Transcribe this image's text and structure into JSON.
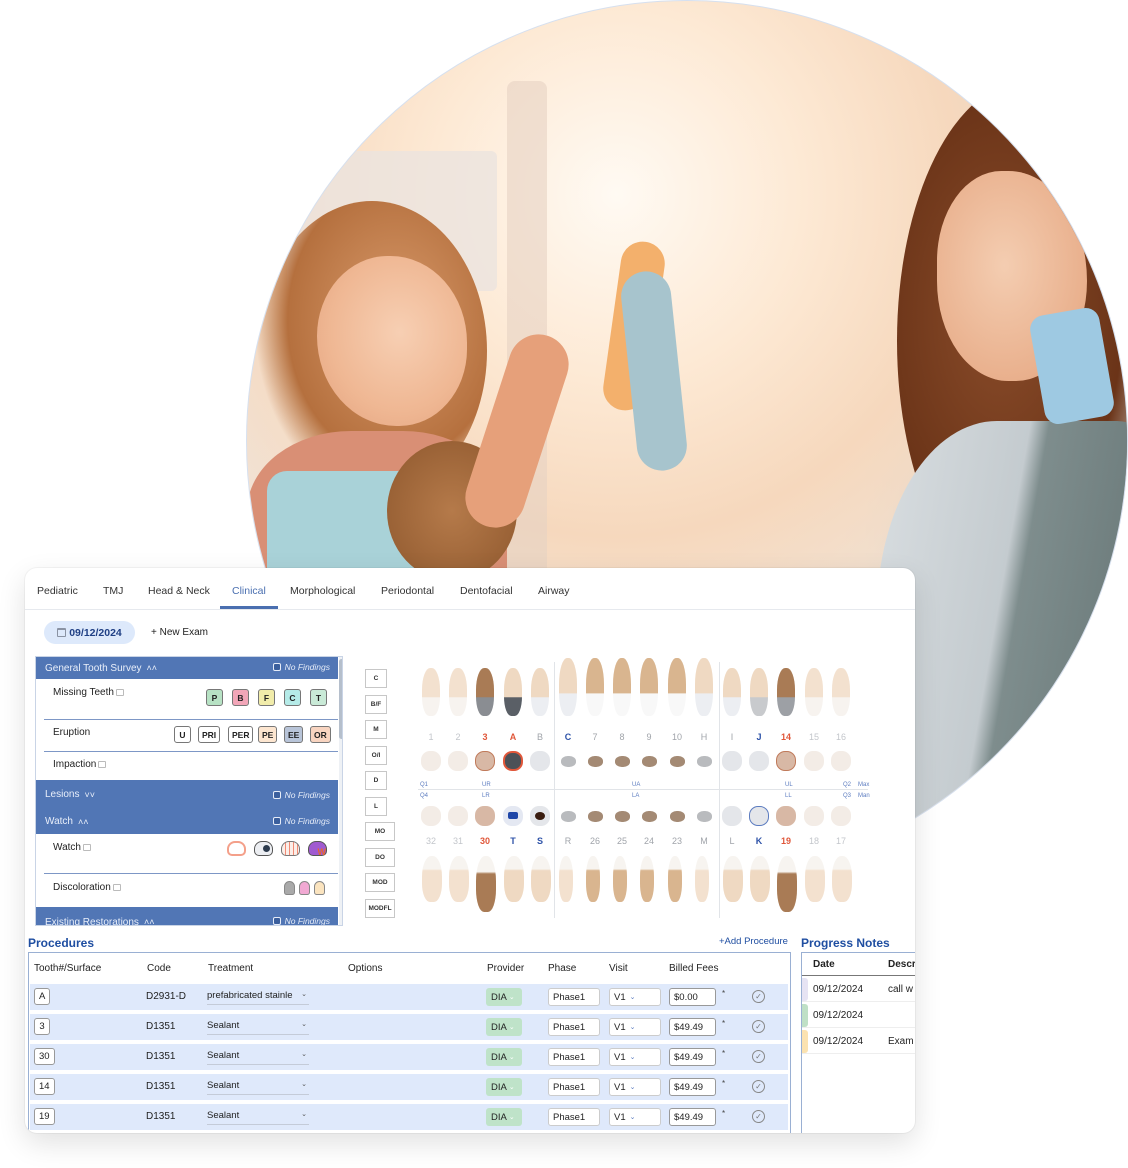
{
  "tabs": [
    "Pediatric",
    "TMJ",
    "Head & Neck",
    "Clinical",
    "Morphological",
    "Periodontal",
    "Dentofacial",
    "Airway"
  ],
  "active_tab": "Clinical",
  "exam": {
    "date": "09/12/2024",
    "new_exam_label": "+ New Exam"
  },
  "survey": {
    "no_findings_label": "No Findings",
    "sections": [
      {
        "title": "General Tooth Survey",
        "chevron": "«",
        "expanded": true
      },
      {
        "title": "Lesions",
        "chevron": "»",
        "expanded": false
      },
      {
        "title": "Watch",
        "chevron": "«",
        "expanded": true
      },
      {
        "title": "Existing Restorations",
        "chevron": "«",
        "expanded": true
      }
    ],
    "missing_teeth": {
      "label": "Missing Teeth",
      "chips": [
        {
          "label": "P",
          "color": "#b7e2c4"
        },
        {
          "label": "B",
          "color": "#f2a6b8"
        },
        {
          "label": "F",
          "color": "#f1ecaa"
        },
        {
          "label": "C",
          "color": "#b5ebe8"
        },
        {
          "label": "T",
          "color": "#c9ead7"
        }
      ]
    },
    "eruption": {
      "label": "Eruption",
      "chips": [
        {
          "label": "U",
          "color": "#ffffff"
        },
        {
          "label": "PRI",
          "color": "#ffffff"
        },
        {
          "label": "PER",
          "color": "#ffffff"
        },
        {
          "label": "PE",
          "color": "#fde6d0"
        },
        {
          "label": "EE",
          "color": "#b8c4d8"
        },
        {
          "label": "OR",
          "color": "#f8d4c0"
        }
      ]
    },
    "impaction_label": "Impaction",
    "watch_label": "Watch",
    "watch_icons": [
      "watch-margin-icon",
      "watch-lesion-icon",
      "watch-fissure-icon",
      "watch-purple-icon"
    ],
    "discoloration": {
      "label": "Discoloration",
      "colors": [
        "#a9a9a9",
        "#f1a9d3",
        "#fbe4bf"
      ]
    }
  },
  "surfaces": [
    "C",
    "B/F",
    "M",
    "O/I",
    "D",
    "L",
    "MO",
    "DO",
    "MOD",
    "MODFL"
  ],
  "tooth_chart": {
    "upper_numbers": [
      {
        "label": "1",
        "style": "light"
      },
      {
        "label": "2",
        "style": "light"
      },
      {
        "label": "3",
        "style": "red"
      },
      {
        "label": "A",
        "style": "red"
      },
      {
        "label": "B",
        "style": "base"
      },
      {
        "label": "C",
        "style": "blue"
      },
      {
        "label": "7",
        "style": "base"
      },
      {
        "label": "8",
        "style": "base"
      },
      {
        "label": "9",
        "style": "base"
      },
      {
        "label": "10",
        "style": "base"
      },
      {
        "label": "H",
        "style": "base"
      },
      {
        "label": "I",
        "style": "base"
      },
      {
        "label": "J",
        "style": "blue"
      },
      {
        "label": "14",
        "style": "red"
      },
      {
        "label": "15",
        "style": "light"
      },
      {
        "label": "16",
        "style": "light"
      }
    ],
    "lower_numbers": [
      {
        "label": "32",
        "style": "light"
      },
      {
        "label": "31",
        "style": "light"
      },
      {
        "label": "30",
        "style": "red"
      },
      {
        "label": "T",
        "style": "blue"
      },
      {
        "label": "S",
        "style": "blue"
      },
      {
        "label": "R",
        "style": "base"
      },
      {
        "label": "26",
        "style": "base"
      },
      {
        "label": "25",
        "style": "base"
      },
      {
        "label": "24",
        "style": "base"
      },
      {
        "label": "23",
        "style": "base"
      },
      {
        "label": "M",
        "style": "base"
      },
      {
        "label": "L",
        "style": "base"
      },
      {
        "label": "K",
        "style": "blue"
      },
      {
        "label": "19",
        "style": "red"
      },
      {
        "label": "18",
        "style": "light"
      },
      {
        "label": "17",
        "style": "light"
      }
    ],
    "quadrant_labels": {
      "q1": "Q1",
      "ur": "UR",
      "ua": "UA",
      "ul": "UL",
      "q2": "Q2",
      "max": "Max",
      "q4": "Q4",
      "lr": "LR",
      "la": "LA",
      "ll": "LL",
      "q3": "Q3",
      "man": "Man"
    }
  },
  "procedures": {
    "title": "Procedures",
    "add_label": "+Add Procedure",
    "columns": [
      "Tooth#/Surface",
      "Code",
      "Treatment",
      "Options",
      "Provider",
      "Phase",
      "Visit",
      "Billed Fees"
    ],
    "rows": [
      {
        "tooth": "A",
        "code": "D2931-D",
        "treatment": "prefabricated stainle",
        "provider": "DIA",
        "phase": "Phase1",
        "visit": "V1",
        "fee": "$0.00",
        "required": "*"
      },
      {
        "tooth": "3",
        "code": "D1351",
        "treatment": "Sealant",
        "provider": "DIA",
        "phase": "Phase1",
        "visit": "V1",
        "fee": "$49.49",
        "required": "*"
      },
      {
        "tooth": "30",
        "code": "D1351",
        "treatment": "Sealant",
        "provider": "DIA",
        "phase": "Phase1",
        "visit": "V1",
        "fee": "$49.49",
        "required": "*"
      },
      {
        "tooth": "14",
        "code": "D1351",
        "treatment": "Sealant",
        "provider": "DIA",
        "phase": "Phase1",
        "visit": "V1",
        "fee": "$49.49",
        "required": "*"
      },
      {
        "tooth": "19",
        "code": "D1351",
        "treatment": "Sealant",
        "provider": "DIA",
        "phase": "Phase1",
        "visit": "V1",
        "fee": "$49.49",
        "required": "*"
      }
    ]
  },
  "progress_notes": {
    "title": "Progress Notes",
    "columns": [
      "Date",
      "Descr"
    ],
    "rows": [
      {
        "date": "09/12/2024",
        "description": "call w",
        "color": "#e6e3f3"
      },
      {
        "date": "09/12/2024",
        "description": "",
        "color": "#bfe0c6"
      },
      {
        "date": "09/12/2024",
        "description": "Exam",
        "color": "#fbe2b0"
      }
    ]
  }
}
